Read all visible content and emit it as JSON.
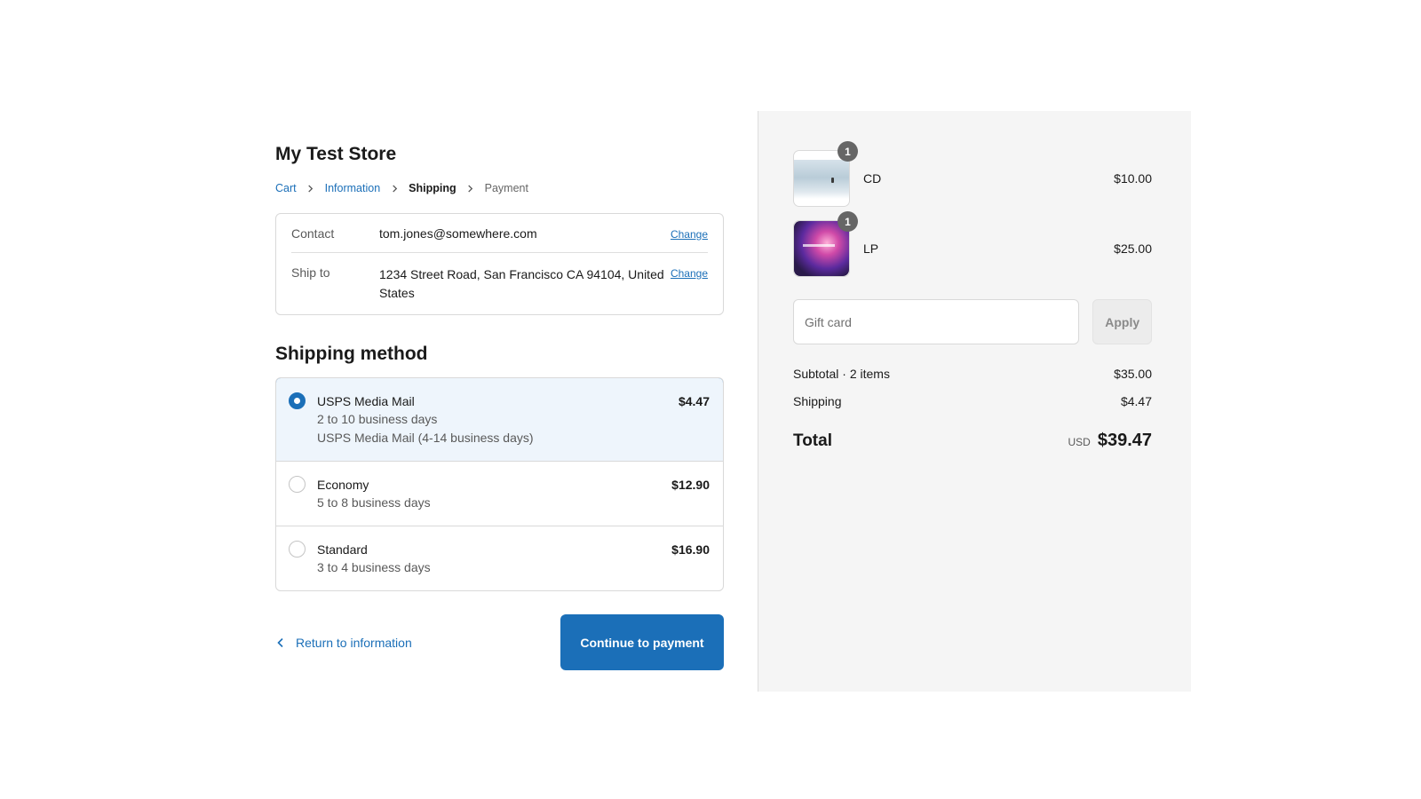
{
  "store": {
    "title": "My Test Store"
  },
  "breadcrumb": {
    "cart": "Cart",
    "information": "Information",
    "shipping": "Shipping",
    "payment": "Payment"
  },
  "review": {
    "contact_label": "Contact",
    "contact_value": "tom.jones@somewhere.com",
    "ship_label": "Ship to",
    "ship_value": "1234 Street Road, San Francisco CA 94104, United States",
    "change_label": "Change"
  },
  "shipping_method": {
    "title": "Shipping method",
    "options": [
      {
        "name": "USPS Media Mail",
        "sub1": "2 to 10 business days",
        "sub2": "USPS Media Mail (4-14 business days)",
        "price": "$4.47",
        "selected": true
      },
      {
        "name": "Economy",
        "sub1": "5 to 8 business days",
        "price": "$12.90",
        "selected": false
      },
      {
        "name": "Standard",
        "sub1": "3 to 4 business days",
        "price": "$16.90",
        "selected": false
      }
    ]
  },
  "actions": {
    "return_label": "Return to information",
    "continue_label": "Continue to payment"
  },
  "summary": {
    "items": [
      {
        "name": "CD",
        "quantity": "1",
        "price": "$10.00"
      },
      {
        "name": "LP",
        "quantity": "1",
        "price": "$25.00"
      }
    ],
    "gift_card_placeholder": "Gift card",
    "apply_label": "Apply",
    "subtotal_label": "Subtotal · 2 items",
    "subtotal_value": "$35.00",
    "shipping_label": "Shipping",
    "shipping_value": "$4.47",
    "total_label": "Total",
    "currency": "USD",
    "total_value": "$39.47"
  },
  "colors": {
    "accent": "#1b6fb8",
    "selected_bg": "#eef5fc",
    "summary_bg": "#f5f5f5"
  }
}
